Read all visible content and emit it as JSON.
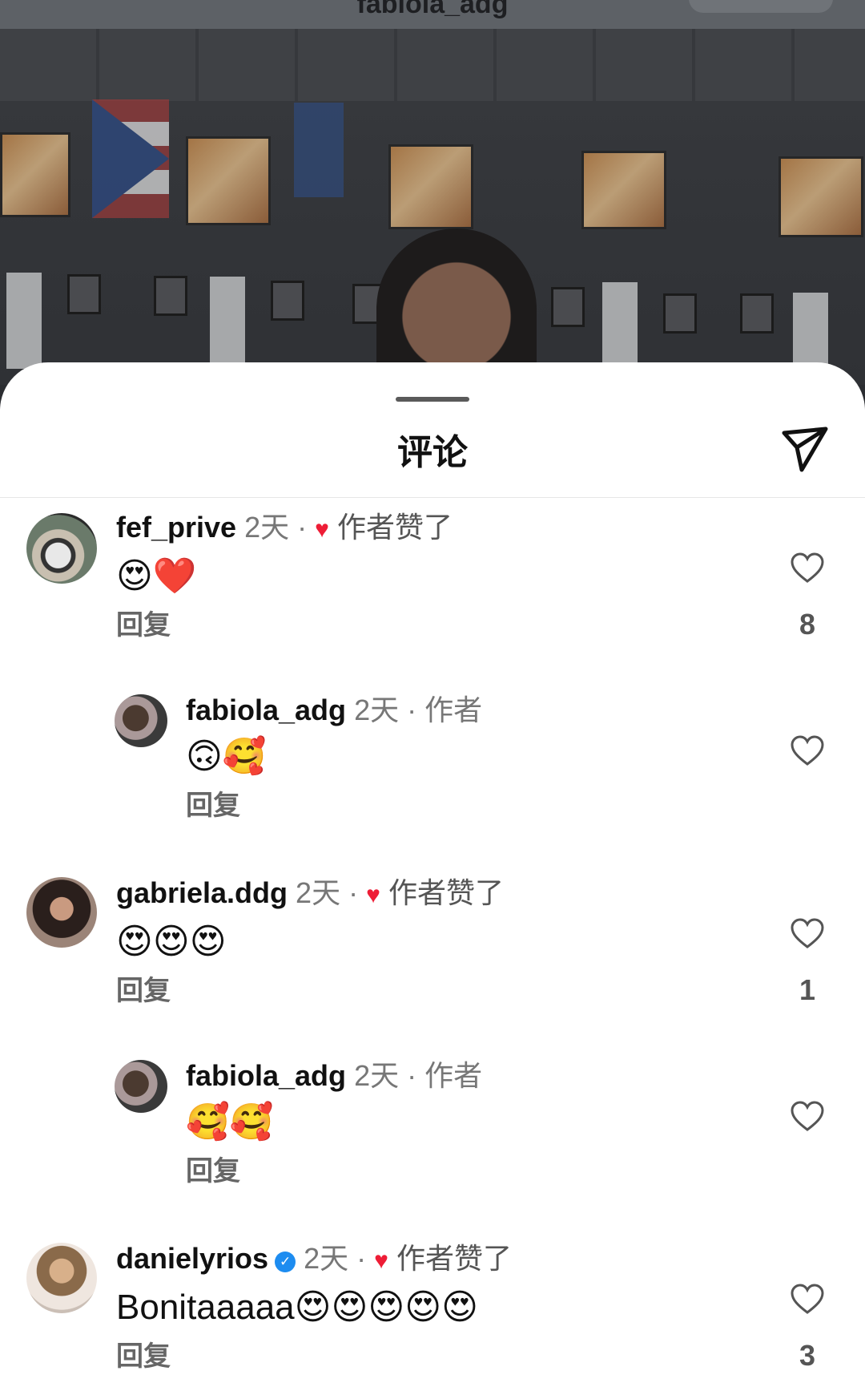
{
  "header": {
    "title": "fabiola_adg"
  },
  "sheet": {
    "title": "评论"
  },
  "icons": {
    "send": "send-icon",
    "like": "heart-outline-icon",
    "liked_badge": "heart-filled-icon",
    "verified": "verified-badge-icon"
  },
  "colors": {
    "accent_red": "#ee1d36",
    "verified_blue": "#1d8cf0"
  },
  "comments": [
    {
      "username": "fef_prive",
      "time": "2天",
      "liked_label": "作者赞了",
      "text": "😍❤️",
      "reply": "回复",
      "likes": "8"
    },
    {
      "username": "fabiola_adg",
      "time": "2天",
      "author_label": "作者",
      "text": "🙃🥰",
      "reply": "回复",
      "likes": ""
    },
    {
      "username": "gabriela.ddg",
      "time": "2天",
      "liked_label": "作者赞了",
      "text": "😍😍😍",
      "reply": "回复",
      "likes": "1"
    },
    {
      "username": "fabiola_adg",
      "time": "2天",
      "author_label": "作者",
      "text": "🥰🥰",
      "reply": "回复",
      "likes": ""
    },
    {
      "username": "danielyrios",
      "time": "2天",
      "liked_label": "作者赞了",
      "text": "Bonitaaaaa😍😍😍😍😍",
      "reply": "回复",
      "likes": "3"
    }
  ]
}
